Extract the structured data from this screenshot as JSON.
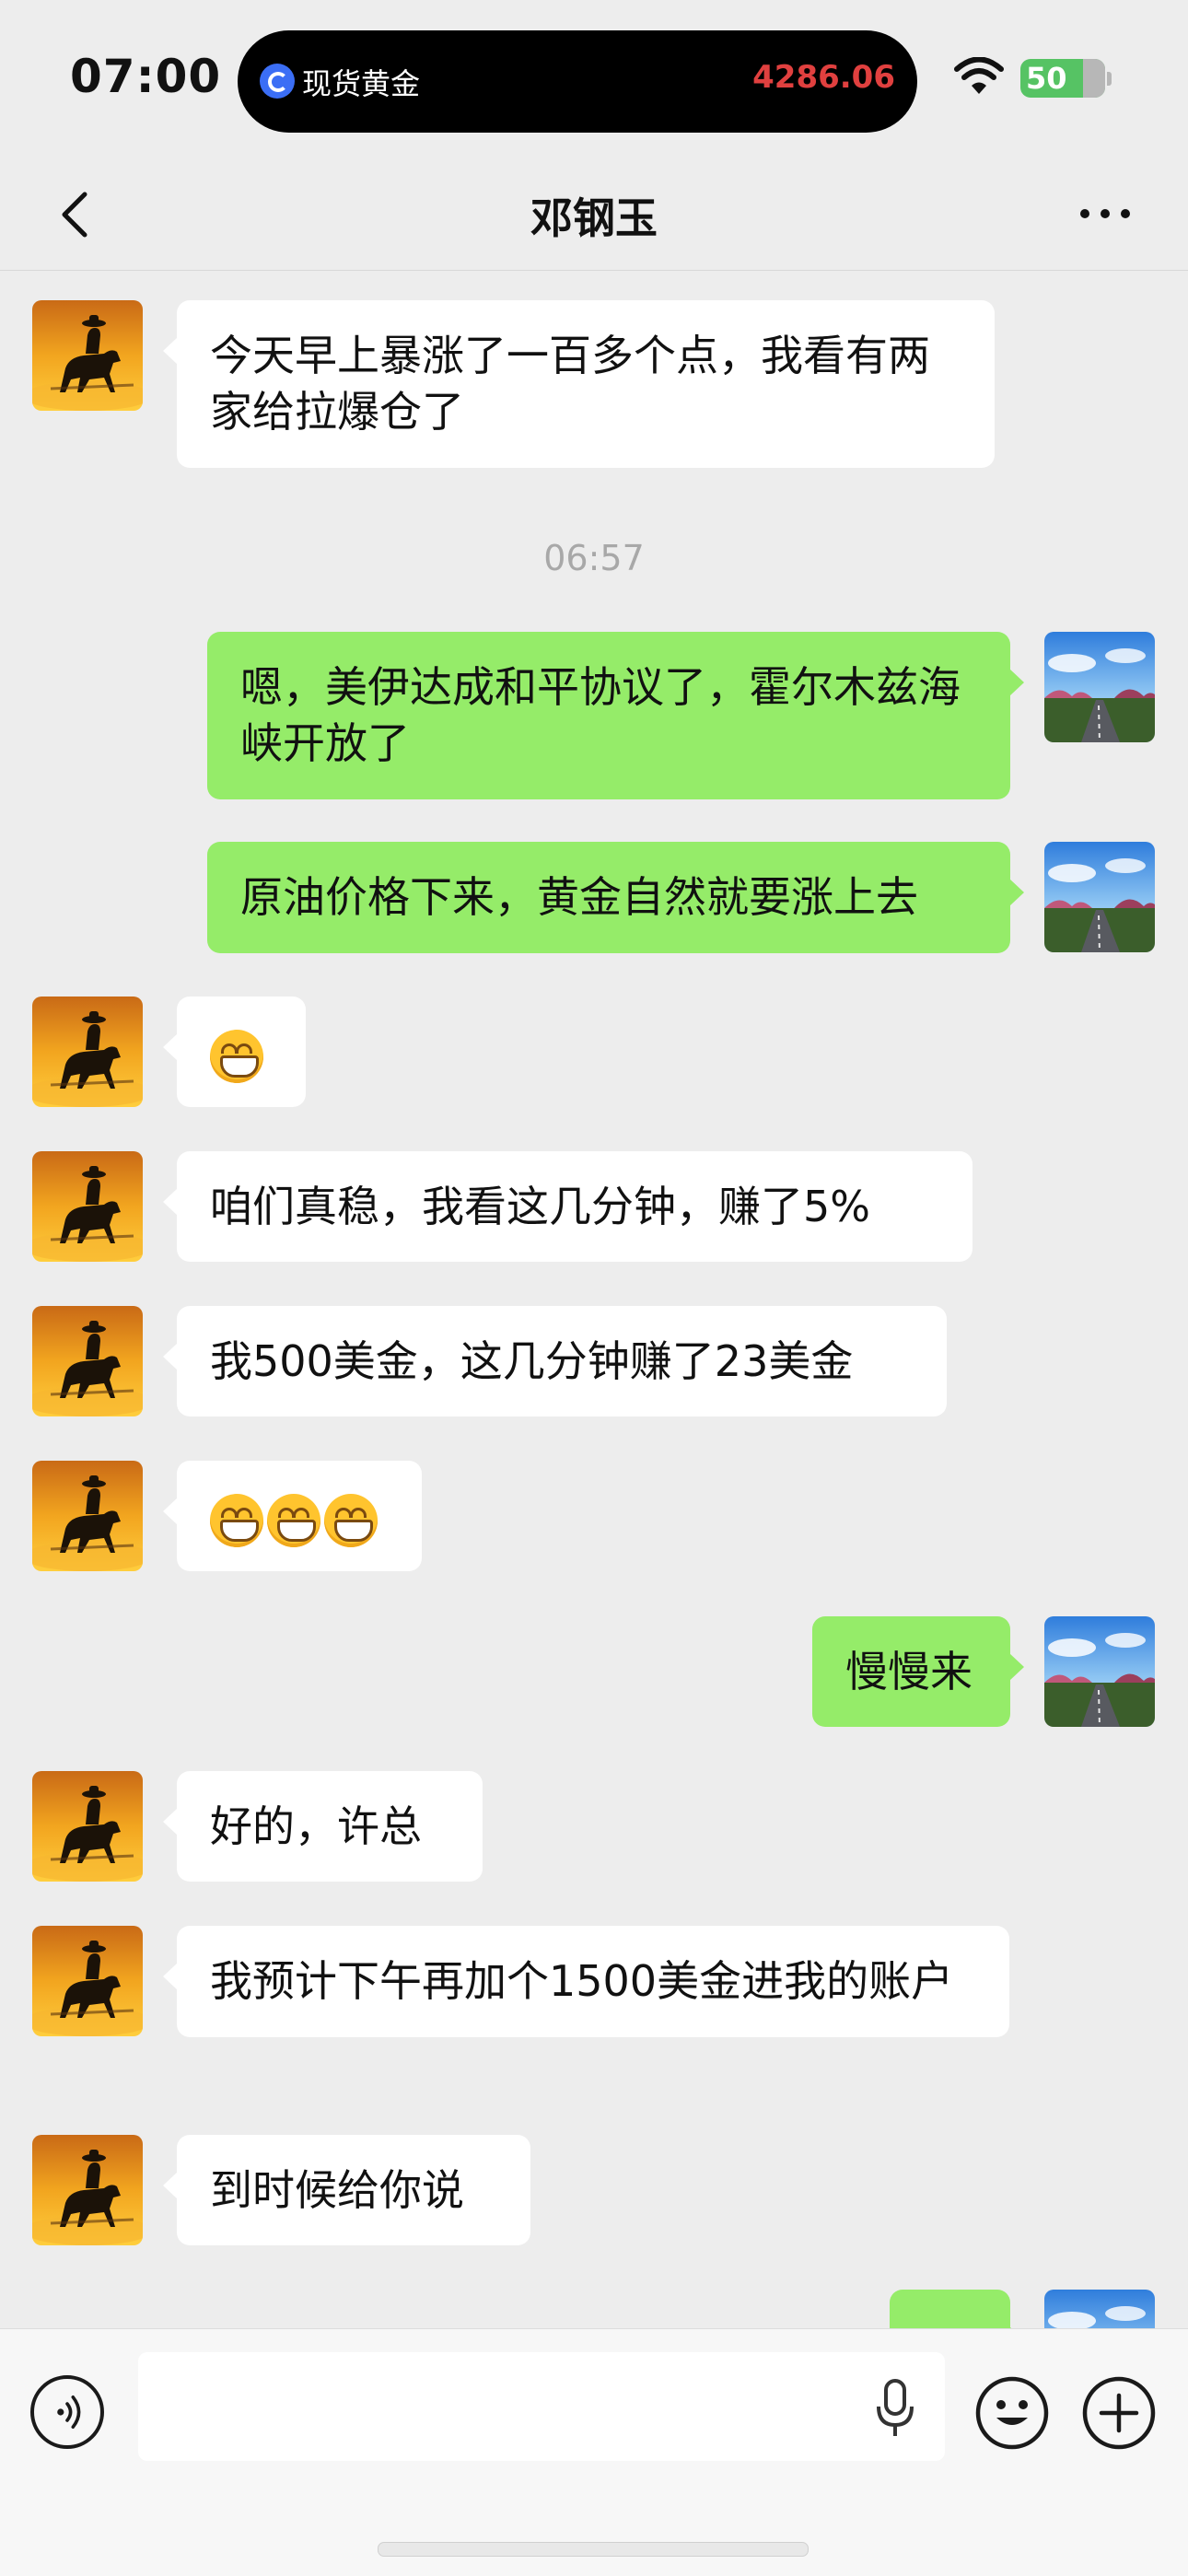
{
  "status_bar": {
    "time": "07:00",
    "live_activity": {
      "title": "现货黄金",
      "price": "4286.06"
    },
    "battery": "50"
  },
  "header": {
    "title": "邓钢玉"
  },
  "messages": [
    {
      "side": "in",
      "type": "text",
      "text": "今天早上暴涨了一百多个点，我看有两家给拉爆仓了"
    },
    {
      "type": "time",
      "text": "06:57"
    },
    {
      "side": "out",
      "type": "text",
      "text": "嗯，美伊达成和平协议了，霍尔木兹海峡开放了"
    },
    {
      "side": "out",
      "type": "text",
      "text": "原油价格下来，黄金自然就要涨上去"
    },
    {
      "side": "in",
      "type": "emoji",
      "emoji": "grinning-face",
      "count": 1
    },
    {
      "side": "in",
      "type": "text",
      "text": "咱们真稳，我看这几分钟，赚了5%"
    },
    {
      "side": "in",
      "type": "text",
      "text": "我500美金，这几分钟赚了23美金"
    },
    {
      "side": "in",
      "type": "emoji",
      "emoji": "grinning-face",
      "count": 3
    },
    {
      "side": "out",
      "type": "text",
      "text": "慢慢来"
    },
    {
      "side": "in",
      "type": "text",
      "text": "好的，许总"
    },
    {
      "side": "in",
      "type": "text",
      "text": "我预计下午再加个1500美金进我的账户"
    },
    {
      "side": "in",
      "type": "text",
      "text": "到时候给你说"
    }
  ],
  "input": {
    "value": "",
    "placeholder": ""
  },
  "colors": {
    "background": "#ededed",
    "outgoing_bubble": "#95ec69",
    "incoming_bubble": "#ffffff",
    "price": "#e0403f",
    "battery": "#56c364"
  },
  "icons": {
    "back": "chevron-left-icon",
    "more": "more-dots-icon",
    "voice": "voice-icon",
    "mic": "microphone-icon",
    "emoji": "smiley-icon",
    "plus": "plus-circle-icon"
  }
}
